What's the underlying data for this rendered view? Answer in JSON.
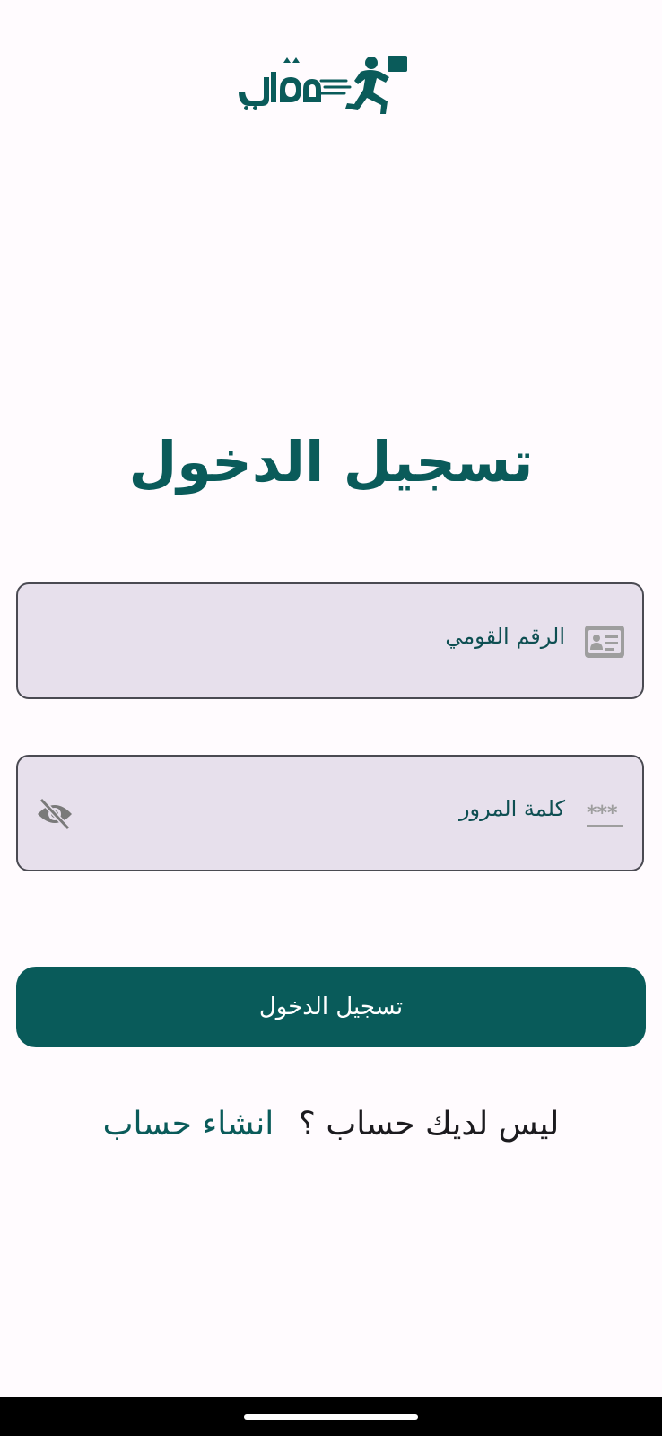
{
  "app": {
    "logo_icon": "delivery-runner-logo"
  },
  "login": {
    "title": "تسجيل الدخول",
    "national_id": {
      "placeholder": "الرقم القومي",
      "icon": "id-card-icon"
    },
    "password": {
      "placeholder": "كلمة المرور",
      "icon": "password-icon",
      "toggle_icon": "eye-off-icon"
    },
    "submit_label": "تسجيل الدخول"
  },
  "signup": {
    "question": "ليس لديك حساب ؟",
    "link_label": "انشاء حساب"
  },
  "colors": {
    "primary": "#095B5A",
    "field_background": "#E7E0EC",
    "background": "#FFFBFE"
  }
}
